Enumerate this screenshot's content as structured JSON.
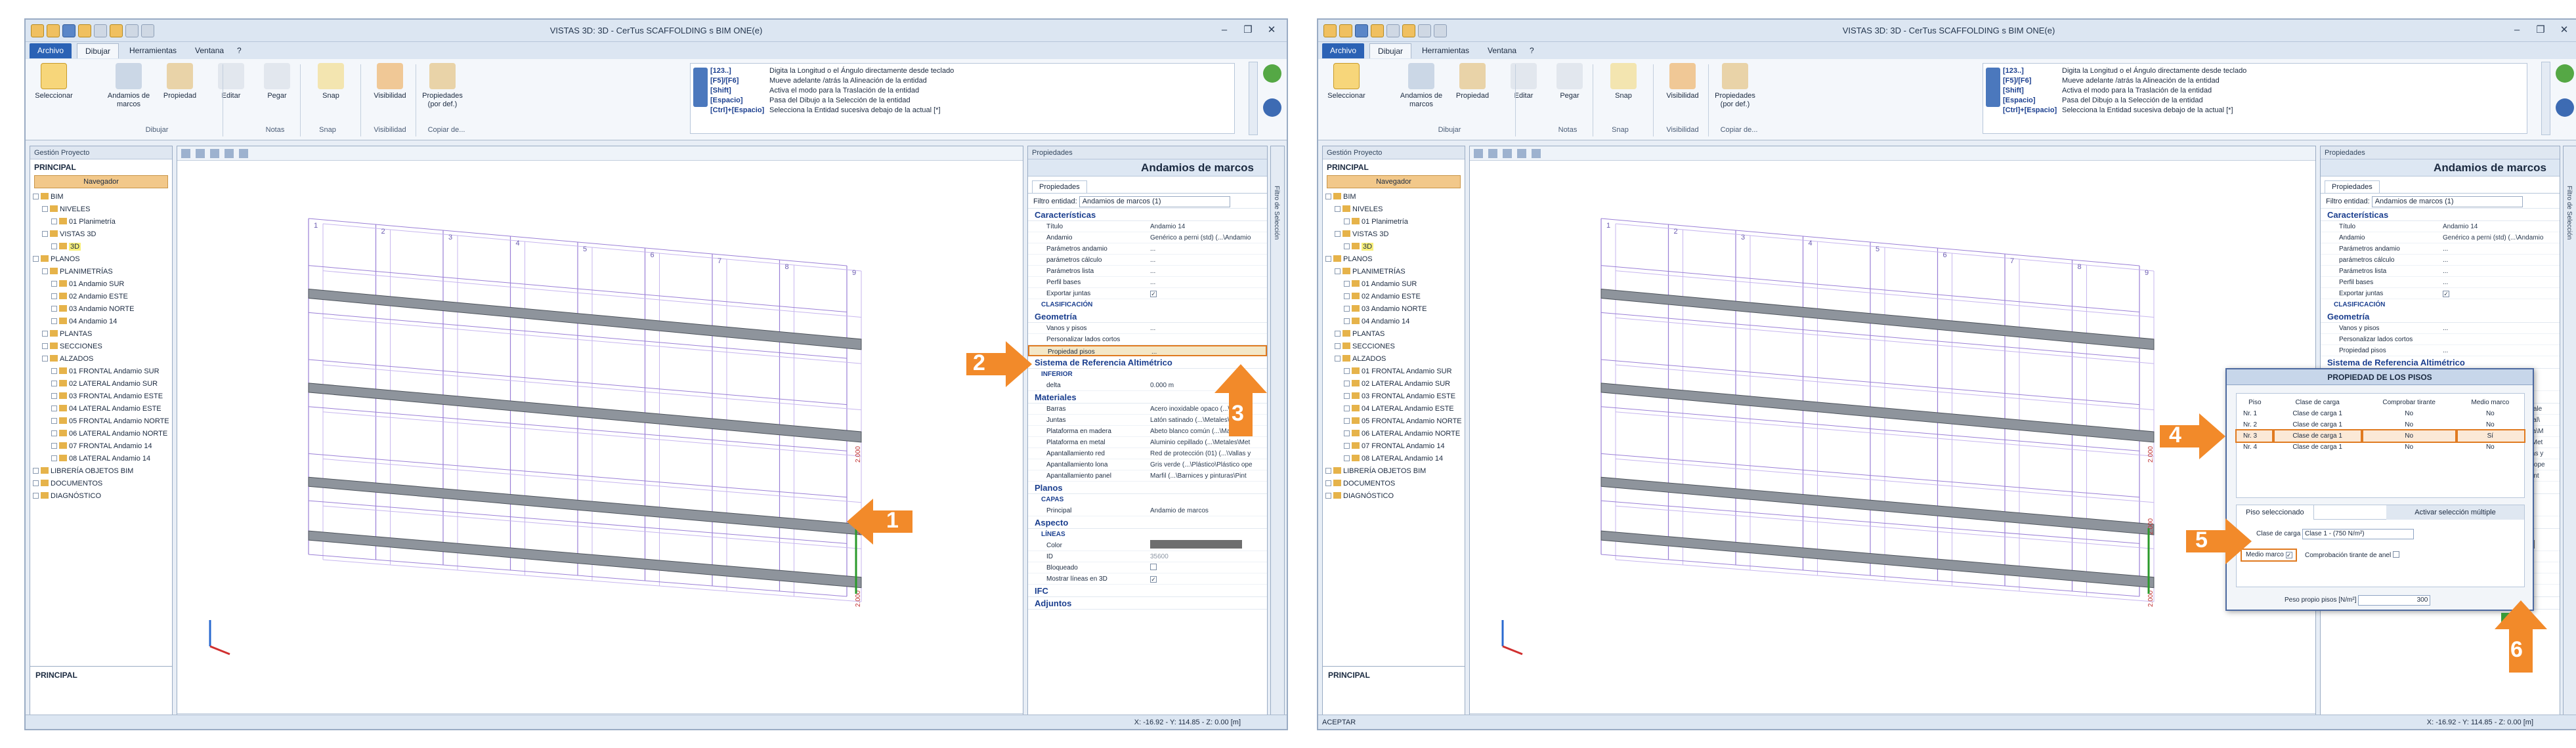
{
  "colors": {
    "accent": "#2b62b5",
    "callout": "#f28a2a",
    "highlight": "#e07a20"
  },
  "windows": [
    {
      "title": "VISTAS 3D: 3D - CerTus SCAFFOLDING s BIM ONE(e)",
      "tabs": [
        "Archivo",
        "Dibujar",
        "Herramientas",
        "Ventana",
        "?"
      ],
      "ribbon": {
        "buttons": [
          {
            "label": "Seleccionar",
            "icon": "select-arrow-icon"
          },
          {
            "label": "Andamios de marcos",
            "icon": "scaffold-frame-icon"
          },
          {
            "label": "Propiedad",
            "icon": "property-icon"
          },
          {
            "label": "Editar",
            "icon": "edit-icon"
          },
          {
            "label": "Pegar",
            "icon": "paste-icon"
          },
          {
            "label": "Snap",
            "icon": "snap-icon"
          },
          {
            "label": "Visibilidad",
            "icon": "visibility-icon"
          },
          {
            "label": "Propiedades (por def.)",
            "icon": "properties-default-icon"
          }
        ],
        "groups": [
          "Dibujar",
          "Notas",
          "Snap",
          "Visibilidad",
          "Copiar de..."
        ]
      },
      "help": [
        {
          "key": "[123..]",
          "text": "Digita la Longitud o el Ángulo directamente desde teclado"
        },
        {
          "key": "[F5]/[F6]",
          "text": "Mueve adelante /atrás la Alineación de la entidad"
        },
        {
          "key": "[Shift]",
          "text": "Activa el modo para la Traslación de la entidad"
        },
        {
          "key": "[Espacio]",
          "text": "Pasa del Dibujo a la Selección de la entidad"
        },
        {
          "key": "[Ctrl]+[Espacio]",
          "text": "Selecciona la Entidad sucesiva debajo de la actual [*]"
        }
      ],
      "left_panel": {
        "header": "Gestión Proyecto",
        "title": "PRINCIPAL",
        "nav_tab": "Navegador",
        "tree": [
          "BIM",
          "NIVELES",
          "01 Planimetría",
          "VISTAS 3D",
          "3D",
          "PLANOS",
          "PLANIMETRÍAS",
          "01 Andamio SUR",
          "02 Andamio ESTE",
          "03 Andamio NORTE",
          "04 Andamio 14",
          "PLANTAS",
          "SECCIONES",
          "ALZADOS",
          "01 FRONTAL Andamio SUR",
          "02 LATERAL Andamio SUR",
          "03 FRONTAL Andamio ESTE",
          "04 LATERAL Andamio ESTE",
          "05 FRONTAL Andamio NORTE",
          "06 LATERAL Andamio NORTE",
          "07 FRONTAL Andamio 14",
          "08 LATERAL Andamio 14",
          "LIBRERÍA OBJETOS BIM",
          "DOCUMENTOS",
          "DIAGNÓSTICO"
        ],
        "bottom_label": "PRINCIPAL"
      },
      "view": {
        "column_numbers": [
          "1",
          "2",
          "3",
          "4",
          "5",
          "6",
          "7",
          "8",
          "9"
        ],
        "dims": [
          "2.000",
          "2.000",
          "2.000"
        ]
      },
      "properties": {
        "header": "Propiedades",
        "entity": "Andamios de marcos",
        "tab": "Propiedades",
        "filter_label": "Filtro entidad:",
        "filter_value": "Andamios de marcos (1)",
        "sections": [
          {
            "title": "Características",
            "rows": [
              {
                "n": "Título",
                "v": "Andamio 14"
              },
              {
                "n": "Andamio",
                "v": "Genérico a perni (std) (...\\Andamio"
              },
              {
                "n": "Parámetros andamio",
                "v": "..."
              },
              {
                "n": "parámetros cálculo",
                "v": "..."
              },
              {
                "n": "Parámetros lista",
                "v": "..."
              },
              {
                "n": "Perfil bases",
                "v": "..."
              },
              {
                "n": "Exportar juntas",
                "v": "✓"
              },
              {
                "n": "CLASIFICACIÓN",
                "v": ""
              }
            ]
          },
          {
            "title": "Geometría",
            "rows": [
              {
                "n": "Vanos y pisos",
                "v": "..."
              },
              {
                "n": "Personalizar lados cortos",
                "v": ""
              },
              {
                "n": "Propiedad pisos",
                "v": "..."
              }
            ]
          },
          {
            "title": "Sistema de Referencia Altimétrico",
            "rows": [
              {
                "n": "INFERIOR",
                "v": ""
              },
              {
                "n": "delta",
                "v": "0.000 m"
              }
            ]
          },
          {
            "title": "Materiales",
            "rows": [
              {
                "n": "Barras",
                "v": "Acero inoxidable opaco (...\\Metale"
              },
              {
                "n": "Juntas",
                "v": "Latón satinado (...\\Metales\\Metal\\"
              },
              {
                "n": "Plataforma en madera",
                "v": "Abeto blanco común (...\\Madera\\M"
              },
              {
                "n": "Plataforma en metal",
                "v": "Aluminio cepillado (...\\Metales\\Met"
              },
              {
                "n": "Apantallamiento red",
                "v": "Red de protección (01) (...\\Vallas y"
              },
              {
                "n": "Apantallamiento lona",
                "v": "Gris verde (...\\Plástico\\Plástico ope"
              },
              {
                "n": "Apantallamiento panel",
                "v": "Marfil (...\\Barnices y pinturas\\Pint"
              }
            ]
          },
          {
            "title": "Planos",
            "rows": [
              {
                "n": "CAPAS",
                "v": ""
              },
              {
                "n": "Principal",
                "v": "Andamio de marcos"
              }
            ]
          },
          {
            "title": "Aspecto",
            "rows": [
              {
                "n": "LÍNEAS",
                "v": ""
              },
              {
                "n": "Color",
                "v": ""
              },
              {
                "n": "ID",
                "v": "35600"
              },
              {
                "n": "Bloqueado",
                "v": ""
              },
              {
                "n": "Mostrar líneas en 3D",
                "v": "✓"
              }
            ]
          },
          {
            "title": "IFC",
            "rows": []
          },
          {
            "title": "Adjuntos",
            "rows": []
          }
        ]
      },
      "side_strip": "Filtro de Selección",
      "status": {
        "left": "",
        "coord": "X: -16.92 - Y: 114.85 - Z: 0.00 [m]"
      },
      "callouts": [
        "1",
        "2",
        "3"
      ]
    },
    {
      "title": "VISTAS 3D: 3D - CerTus SCAFFOLDING s BIM ONE(e)",
      "status": {
        "left": "ACEPTAR",
        "coord": "X: -16.92 - Y: 114.85 - Z: 0.00 [m]"
      },
      "callouts": [
        "4",
        "5",
        "6"
      ],
      "dialog": {
        "title": "PROPIEDAD DE LOS PISOS",
        "headers": [
          "Piso",
          "Clase de carga",
          "Comprobar tirante",
          "Medio marco"
        ],
        "rows": [
          [
            "Nr. 1",
            "Clase de carga 1",
            "No",
            "No"
          ],
          [
            "Nr. 2",
            "Clase de carga 1",
            "No",
            "No"
          ],
          [
            "Nr. 3",
            "Clase de carga 1",
            "No",
            "Sí"
          ],
          [
            "Nr. 4",
            "Clase de carga 1",
            "No",
            "No"
          ]
        ],
        "tab_selected": "Piso seleccionado",
        "tab_multi": "Activar selección múltiple",
        "load_label": "Clase de carga",
        "load_value": "Clase 1 - (750 N/m²)",
        "half_frame_label": "Medio marco",
        "check_tie_label": "Comprobación tirante de anel",
        "weight_label": "Peso propio pisos [N/m²]",
        "weight_value": "300"
      }
    }
  ]
}
